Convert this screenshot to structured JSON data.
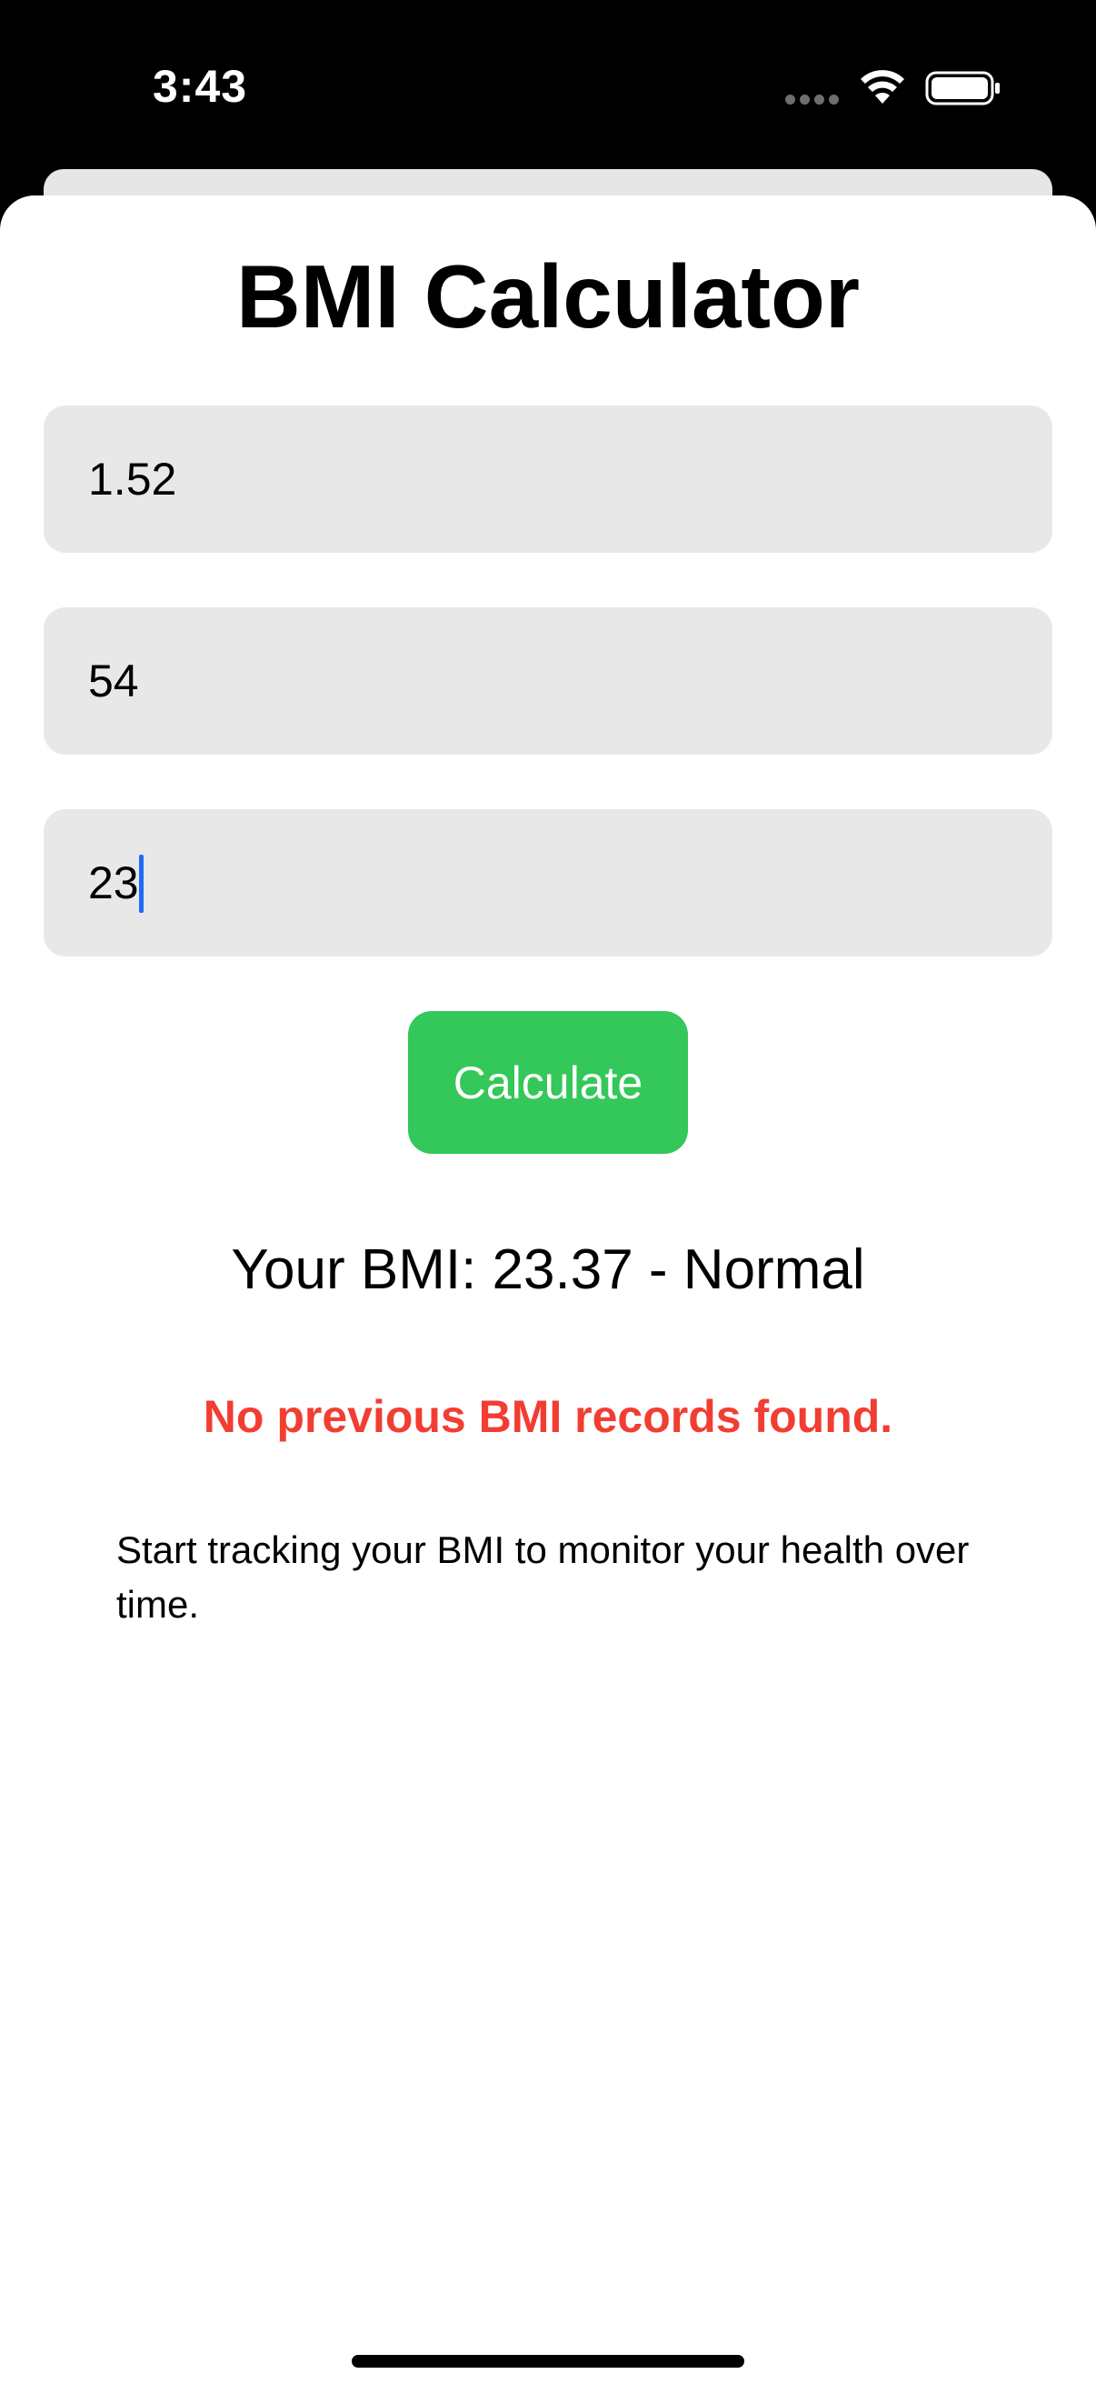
{
  "status_bar": {
    "time": "3:43"
  },
  "app": {
    "title": "BMI Calculator"
  },
  "inputs": {
    "height_value": "1.52",
    "weight_value": "54",
    "age_value": "23"
  },
  "actions": {
    "calculate_label": "Calculate"
  },
  "result": {
    "bmi_text": "Your BMI: 23.37 - Normal"
  },
  "history": {
    "empty_message": "No previous BMI records found.",
    "hint": "Start tracking your BMI to monitor your health over time."
  },
  "colors": {
    "accent_green": "#34c759",
    "error_red": "#f23d32",
    "field_background": "#e8e8e8",
    "caret_blue": "#1e6cf2"
  },
  "icons": {
    "signal": "cellular-signal-icon",
    "wifi": "wifi-icon",
    "battery": "battery-icon"
  }
}
